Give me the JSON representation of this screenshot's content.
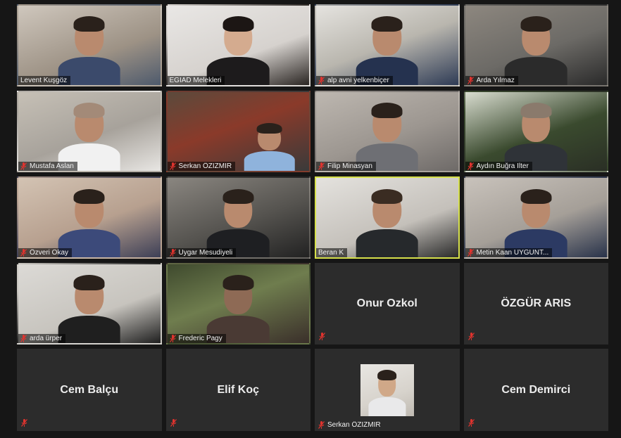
{
  "colors": {
    "background": "#161616",
    "tile": "#2c2c2c",
    "active_speaker_border": "#d6e04a",
    "muted_mic": "#e0332e"
  },
  "participants": [
    {
      "name": "Levent Kuşgöz",
      "video": true,
      "muted": false
    },
    {
      "name": "EGİAD Melekleri",
      "video": true,
      "muted": false
    },
    {
      "name": "alp avni yelkenbiçer",
      "video": true,
      "muted": true
    },
    {
      "name": "Arda Yılmaz",
      "video": true,
      "muted": true
    },
    {
      "name": "Mustafa Aslan",
      "video": true,
      "muted": true
    },
    {
      "name": "Serkan ÖZİZMİR",
      "video": true,
      "muted": true
    },
    {
      "name": "Filip Minasyan",
      "video": true,
      "muted": true
    },
    {
      "name": "Aydın Buğra İlter",
      "video": true,
      "muted": true
    },
    {
      "name": "Özveri Okay",
      "video": true,
      "muted": true
    },
    {
      "name": "Uygar Mesudiyeli",
      "video": true,
      "muted": true
    },
    {
      "name": "Beran K",
      "video": true,
      "muted": false,
      "active": true
    },
    {
      "name": "Metin Kaan UYGUNT...",
      "video": true,
      "muted": true
    },
    {
      "name": "arda ürper",
      "video": true,
      "muted": true
    },
    {
      "name": "Frederic Pagy",
      "video": true,
      "muted": true
    },
    {
      "name": "Onur Ozkol",
      "video": false,
      "muted": true
    },
    {
      "name": "ÖZGÜR ARIS",
      "video": false,
      "muted": true
    },
    {
      "name": "Cem Balçu",
      "video": false,
      "muted": true
    },
    {
      "name": "Elif Koç",
      "video": false,
      "muted": true
    },
    {
      "name": "Serkan ÖZİZMİR",
      "video": false,
      "muted": true,
      "profile_photo": true
    },
    {
      "name": "Cem Demirci",
      "video": false,
      "muted": true
    }
  ],
  "icons": {
    "muted": "muted-mic-icon"
  }
}
